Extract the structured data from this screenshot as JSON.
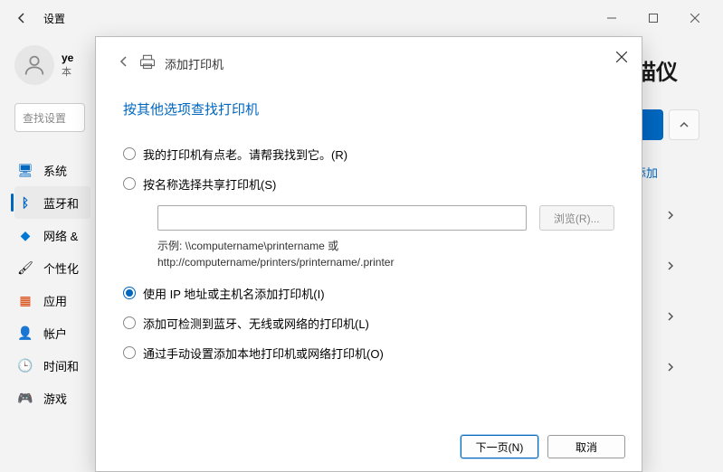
{
  "header": {
    "title": "设置"
  },
  "user": {
    "name": "ye",
    "sub": "本"
  },
  "search": {
    "placeholder": "查找设置"
  },
  "sidebar": {
    "items": [
      {
        "label": "系统",
        "icon": "🖥"
      },
      {
        "label": "蓝牙和",
        "icon": "ᛒ"
      },
      {
        "label": "网络 &",
        "icon": "◆"
      },
      {
        "label": "个性化",
        "icon": "🖌"
      },
      {
        "label": "应用",
        "icon": "▦"
      },
      {
        "label": "帐户",
        "icon": "👤"
      },
      {
        "label": "时间和",
        "icon": "🕒"
      },
      {
        "label": "游戏",
        "icon": "🎮"
      }
    ]
  },
  "right": {
    "title_fragment": "描仪",
    "link": "添加"
  },
  "dialog": {
    "title": "添加打印机",
    "heading": "按其他选项查找打印机",
    "options": [
      {
        "label": "我的打印机有点老。请帮我找到它。(R)"
      },
      {
        "label": "按名称选择共享打印机(S)"
      },
      {
        "label": "使用 IP 地址或主机名添加打印机(I)"
      },
      {
        "label": "添加可检测到蓝牙、无线或网络的打印机(L)"
      },
      {
        "label": "通过手动设置添加本地打印机或网络打印机(O)"
      }
    ],
    "browse_label": "浏览(R)...",
    "example_line1": "示例: \\\\computername\\printername 或",
    "example_line2": "http://computername/printers/printername/.printer",
    "next_label": "下一页(N)",
    "cancel_label": "取消"
  }
}
